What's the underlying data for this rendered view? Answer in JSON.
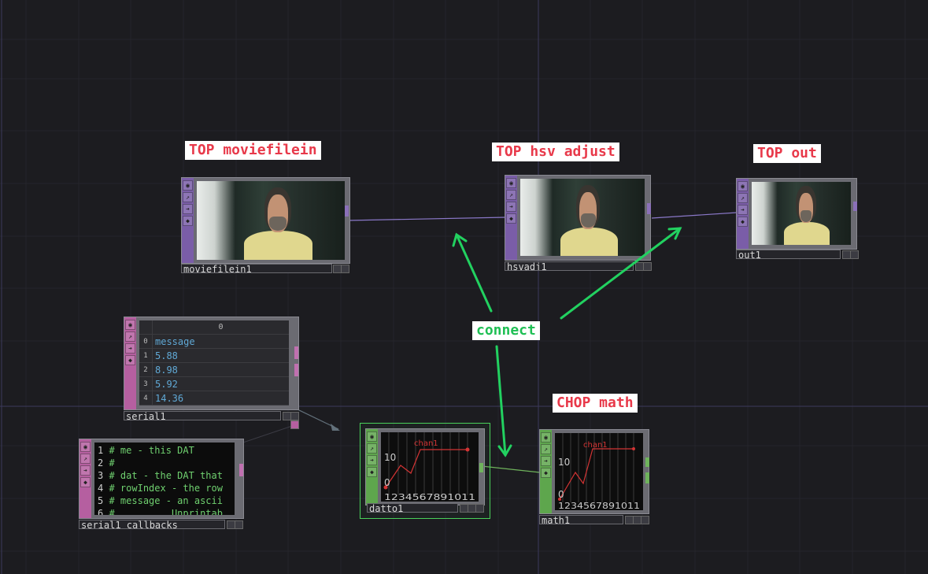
{
  "annotations": {
    "moviefilein_title": "TOP moviefilein",
    "hsv_title": "TOP hsv adjust",
    "out_title": "TOP out",
    "connect": "connect",
    "math_title": "CHOP math"
  },
  "nodes": {
    "moviefilein": {
      "label": "moviefilein1"
    },
    "hsvadj": {
      "label": "hsvadj1"
    },
    "out": {
      "label": "out1"
    },
    "serial": {
      "label": "serial1",
      "column_header": "0",
      "rows": [
        {
          "index": "0",
          "value": "message"
        },
        {
          "index": "1",
          "value": "5.88"
        },
        {
          "index": "2",
          "value": "8.98"
        },
        {
          "index": "3",
          "value": "5.92"
        },
        {
          "index": "4",
          "value": "14.36"
        }
      ]
    },
    "serial_callbacks": {
      "label": "serial1_callbacks",
      "lines": [
        {
          "num": "1",
          "text": "# me - this DAT"
        },
        {
          "num": "2",
          "text": "#"
        },
        {
          "num": "3",
          "text": "# dat - the DAT that"
        },
        {
          "num": "4",
          "text": "# rowIndex - the row"
        },
        {
          "num": "5",
          "text": "# message - an ascii"
        },
        {
          "num": "6",
          "text": "#          Unprintab"
        }
      ]
    },
    "datto": {
      "label": "datto1",
      "channel": "chan1",
      "y_label_high": "10",
      "y_label_low": "0",
      "x_labels": [
        "1",
        "2",
        "3",
        "4",
        "5",
        "6",
        "7",
        "8",
        "9",
        "10",
        "11"
      ]
    },
    "math": {
      "label": "math1",
      "channel": "chan1",
      "y_label_high": "10",
      "y_label_low": "0",
      "x_labels": [
        "1",
        "2",
        "3",
        "4",
        "5",
        "6",
        "7",
        "8",
        "9",
        "10",
        "11"
      ]
    }
  },
  "icons": [
    "viewer-icon",
    "bypass-icon",
    "cook-icon",
    "lock-icon"
  ],
  "colors": {
    "top_family": "#7a5da8",
    "dat_family": "#b55fa0",
    "chop_family": "#5ea64d",
    "annotation_text": "#e8394a",
    "connect_text": "#1fbf54",
    "arrow": "#22d160"
  }
}
